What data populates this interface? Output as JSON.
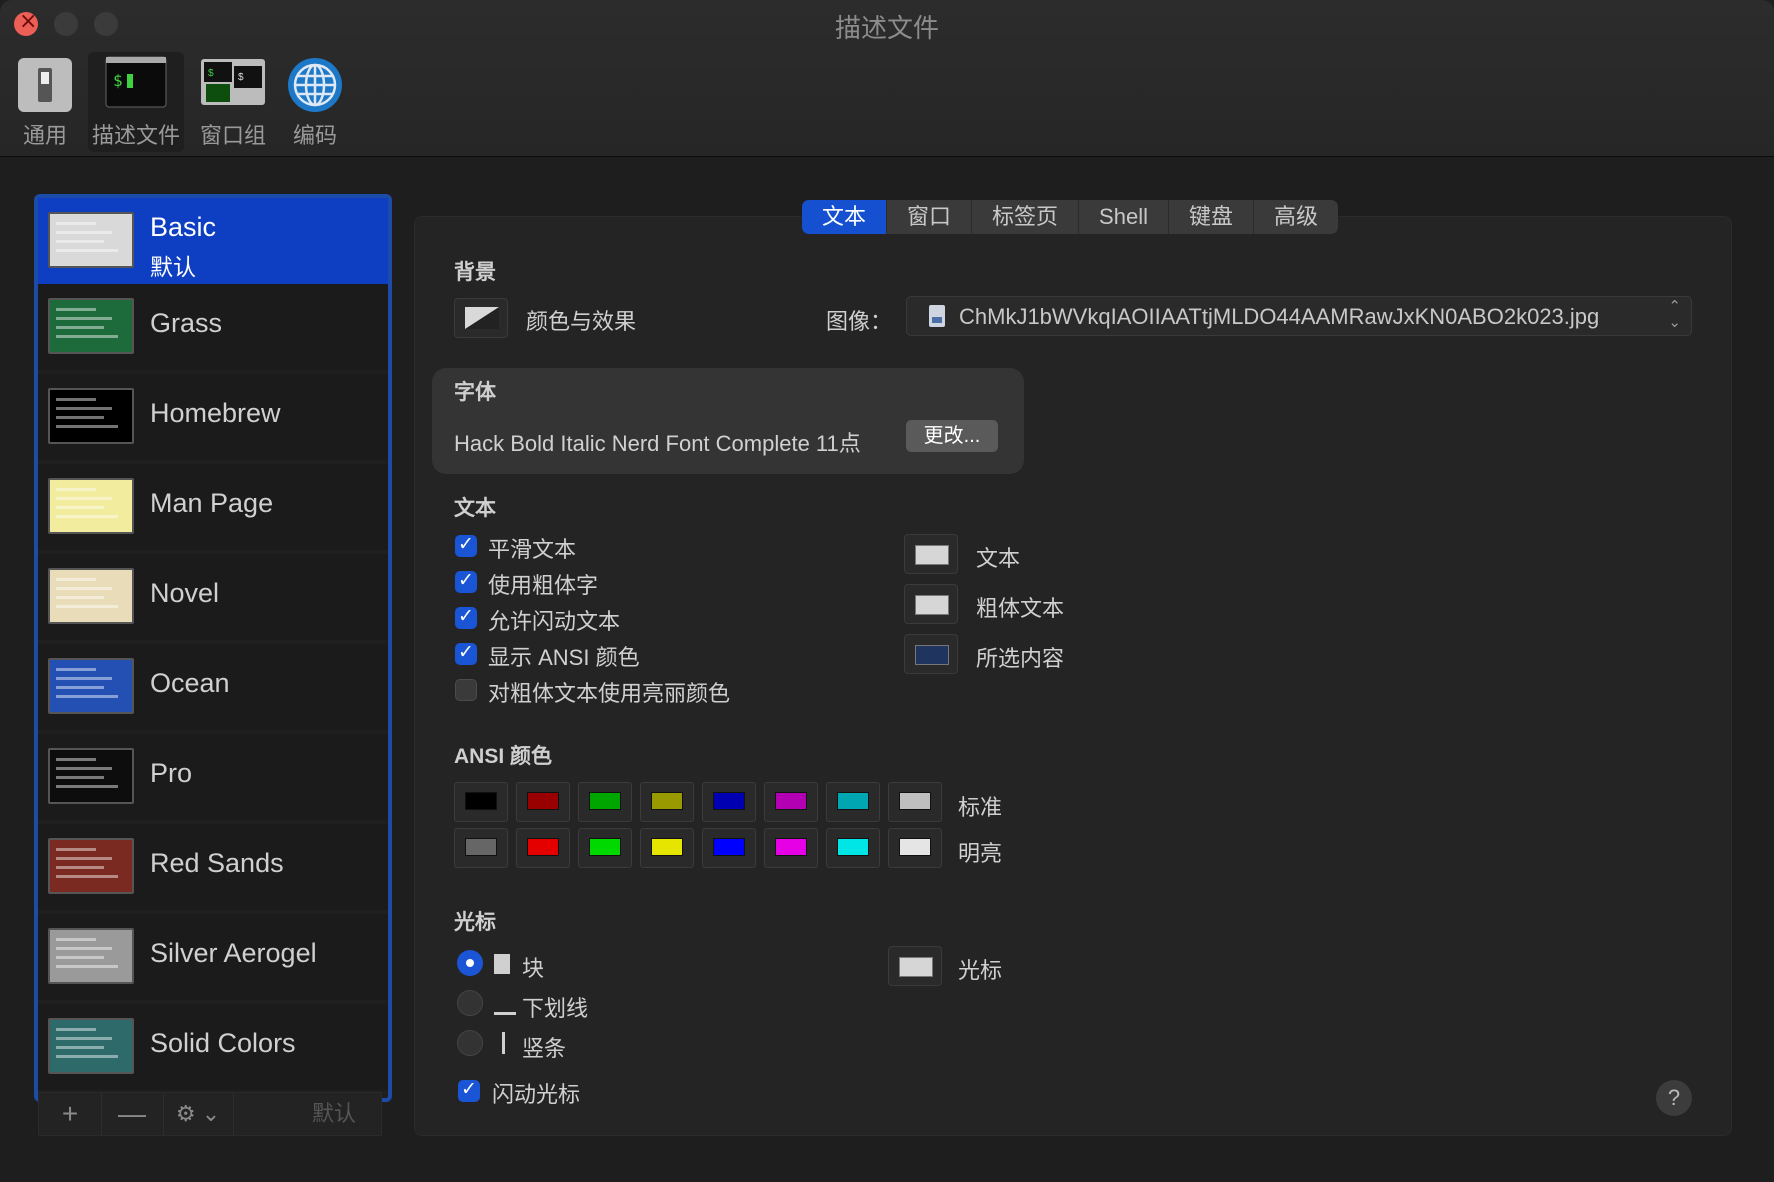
{
  "window": {
    "title": "描述文件"
  },
  "toolbar": {
    "items": [
      {
        "label": "通用"
      },
      {
        "label": "描述文件"
      },
      {
        "label": "窗口组"
      },
      {
        "label": "编码"
      }
    ]
  },
  "profiles": [
    {
      "name": "Basic",
      "sub": "默认",
      "thumb": "#d9d9d9"
    },
    {
      "name": "Grass",
      "thumb": "#1d6b3a"
    },
    {
      "name": "Homebrew",
      "thumb": "#000000"
    },
    {
      "name": "Man Page",
      "thumb": "#f2ec9f"
    },
    {
      "name": "Novel",
      "thumb": "#e8dcb9"
    },
    {
      "name": "Ocean",
      "thumb": "#2450b4"
    },
    {
      "name": "Pro",
      "thumb": "#0d0d0d"
    },
    {
      "name": "Red Sands",
      "thumb": "#7a2a20"
    },
    {
      "name": "Silver Aerogel",
      "thumb": "#9a9a9a"
    },
    {
      "name": "Solid Colors",
      "thumb": "#2f6a6a"
    }
  ],
  "list_controls": {
    "add": "+",
    "remove": "—",
    "gear": "⚙ ⌄",
    "default": "默认"
  },
  "tabs": [
    "文本",
    "窗口",
    "标签页",
    "Shell",
    "键盘",
    "高级"
  ],
  "background": {
    "title": "背景",
    "color_effects": "颜色与效果",
    "image_label": "图像：",
    "image_value": "ChMkJ1bWVkqIAOIIAATtjMLDO44AAMRawJxKN0ABO2k023.jpg"
  },
  "font": {
    "title": "字体",
    "value": "Hack Bold Italic Nerd Font Complete 11点",
    "change": "更改..."
  },
  "text": {
    "title": "文本",
    "options": [
      {
        "label": "平滑文本",
        "checked": true
      },
      {
        "label": "使用粗体字",
        "checked": true
      },
      {
        "label": "允许闪动文本",
        "checked": true
      },
      {
        "label": "显示 ANSI 颜色",
        "checked": true
      },
      {
        "label": "对粗体文本使用亮丽颜色",
        "checked": false
      }
    ],
    "colors": [
      {
        "label": "文本",
        "color": "#d6d6d6"
      },
      {
        "label": "粗体文本",
        "color": "#d6d6d6"
      },
      {
        "label": "所选内容",
        "color": "#1f3560"
      }
    ]
  },
  "ansi": {
    "title": "ANSI 颜色",
    "standard_label": "标准",
    "bright_label": "明亮",
    "standard": [
      "#000000",
      "#990000",
      "#00a600",
      "#999900",
      "#0000b2",
      "#b200b2",
      "#00a6b2",
      "#bfbfbf"
    ],
    "bright": [
      "#666666",
      "#e50000",
      "#00d900",
      "#e5e500",
      "#0000ff",
      "#e500e5",
      "#00e5e5",
      "#e5e5e5"
    ]
  },
  "cursor": {
    "title": "光标",
    "block_label": "块",
    "underline_label": "下划线",
    "bar_label": "竖条",
    "blink_label": "闪动光标",
    "color_label": "光标",
    "color": "#d6d6d6"
  },
  "help": "?"
}
